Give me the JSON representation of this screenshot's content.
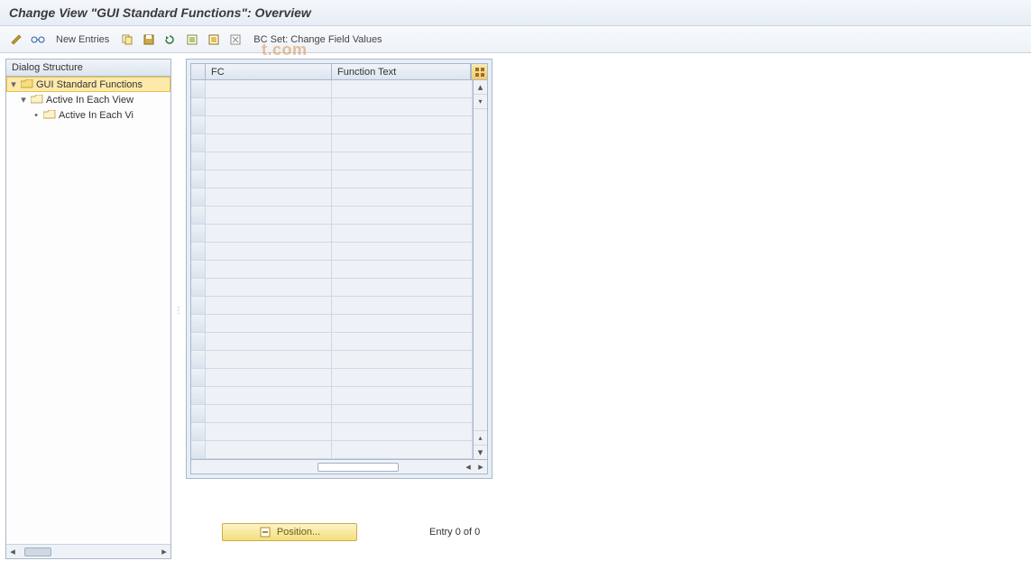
{
  "title": "Change View \"GUI Standard Functions\": Overview",
  "toolbar": {
    "new_entries": "New Entries",
    "bc_set": "BC Set: Change Field Values"
  },
  "left": {
    "header": "Dialog Structure",
    "nodes": {
      "root": "GUI Standard Functions",
      "child1": "Active In Each View",
      "child2": "Active In Each Vi"
    }
  },
  "grid": {
    "col_fc": "FC",
    "col_ft": "Function Text",
    "rows": 21
  },
  "footer": {
    "position": "Position...",
    "entry": "Entry 0 of 0"
  },
  "watermark": "t.com"
}
